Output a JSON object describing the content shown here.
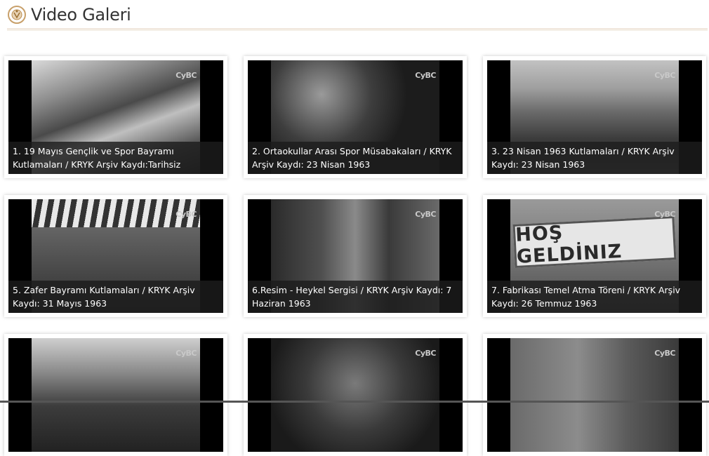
{
  "page": {
    "title": "Video Galeri"
  },
  "videos": [
    {
      "caption": "1. 19 Mayıs Gençlik ve Spor Bayramı Kutlamaları / KRYK Arşiv Kaydı:Tarihsiz",
      "logo": "CyBC"
    },
    {
      "caption": "2. Ortaokullar Arası Spor Müsabakaları / KRYK Arşiv Kaydı: 23 Nisan 1963",
      "logo": "CyBC"
    },
    {
      "caption": "3. 23 Nisan 1963 Kutlamaları / KRYK Arşiv Kaydı: 23 Nisan 1963",
      "logo": "CyBC"
    },
    {
      "caption": "5. Zafer Bayramı Kutlamaları / KRYK Arşiv Kaydı: 31 Mayıs 1963",
      "logo": "CyBC"
    },
    {
      "caption": "6.Resim - Heykel Sergisi / KRYK Arşiv Kaydı: 7 Haziran 1963",
      "logo": "CyBC"
    },
    {
      "caption": "7. Fabrikası Temel Atma Töreni / KRYK Arşiv Kaydı: 26 Temmuz 1963",
      "logo": "CyBC",
      "banner": "HOŞ GELDİNIZ"
    },
    {
      "caption": "",
      "logo": "CyBC"
    },
    {
      "caption": "",
      "logo": "CyBC"
    },
    {
      "caption": "",
      "logo": "CyBC"
    }
  ]
}
